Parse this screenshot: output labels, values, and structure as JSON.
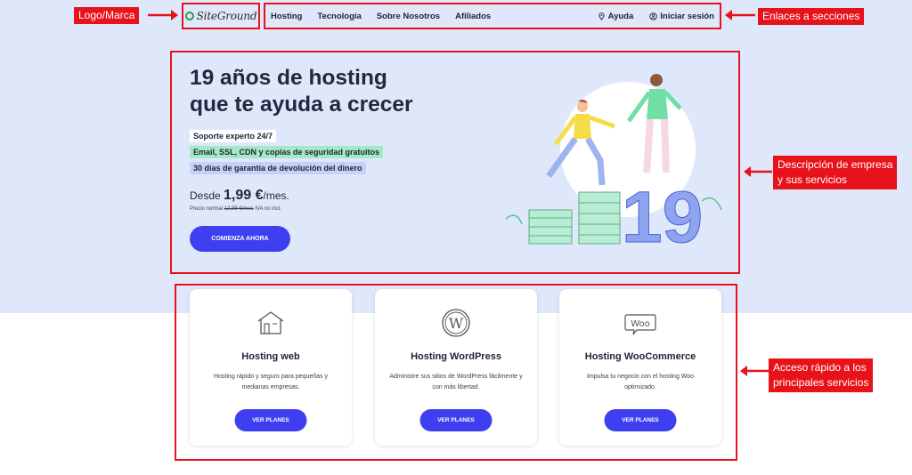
{
  "header": {
    "logo_text": "SiteGround",
    "nav": [
      "Hosting",
      "Tecnología",
      "Sobre Nosotros",
      "Afiliados"
    ],
    "help": "Ayuda",
    "login": "Iniciar sesión"
  },
  "annotations": {
    "logo": "Logo/Marca",
    "nav": "Enlaces a secciones",
    "hero_line1": "Descripción de empresa",
    "hero_line2": "y sus servicios",
    "cards_line1": "Acceso rápido a los",
    "cards_line2": "principales servicios"
  },
  "hero": {
    "title_line1": "19 años de hosting",
    "title_line2": "que te ayuda a crecer",
    "badges": [
      "Soporte experto 24/7",
      "Email, SSL, CDN y copias de seguridad gratuitos",
      "30 días de garantía de devolución del dinero"
    ],
    "price_prefix": "Desde",
    "price": "1,99 €",
    "price_suffix": "/mes.",
    "note_prefix": "Precio normal",
    "note_old": "12,99 €/mes",
    "note_suffix": "IVA no incl.",
    "cta": "COMIENZA AHORA",
    "illustration_number": "19"
  },
  "cards": [
    {
      "icon": "house-icon",
      "title": "Hosting web",
      "desc": "Hosting rápido y seguro para pequeñas y medianas empresas.",
      "button": "VER PLANES"
    },
    {
      "icon": "wordpress-icon",
      "title": "Hosting WordPress",
      "desc": "Administre sus sitios de WordPress fácilmente y con más libertad.",
      "button": "VER PLANES"
    },
    {
      "icon": "woo-icon",
      "title": "Hosting WooCommerce",
      "desc": "Impulsa tu negocio con el hosting Woo optimizado.",
      "button": "VER PLANES"
    }
  ],
  "colors": {
    "accent": "#3e3ff0",
    "annotation": "#e8121a",
    "hero_bg": "#dfe8fb"
  }
}
